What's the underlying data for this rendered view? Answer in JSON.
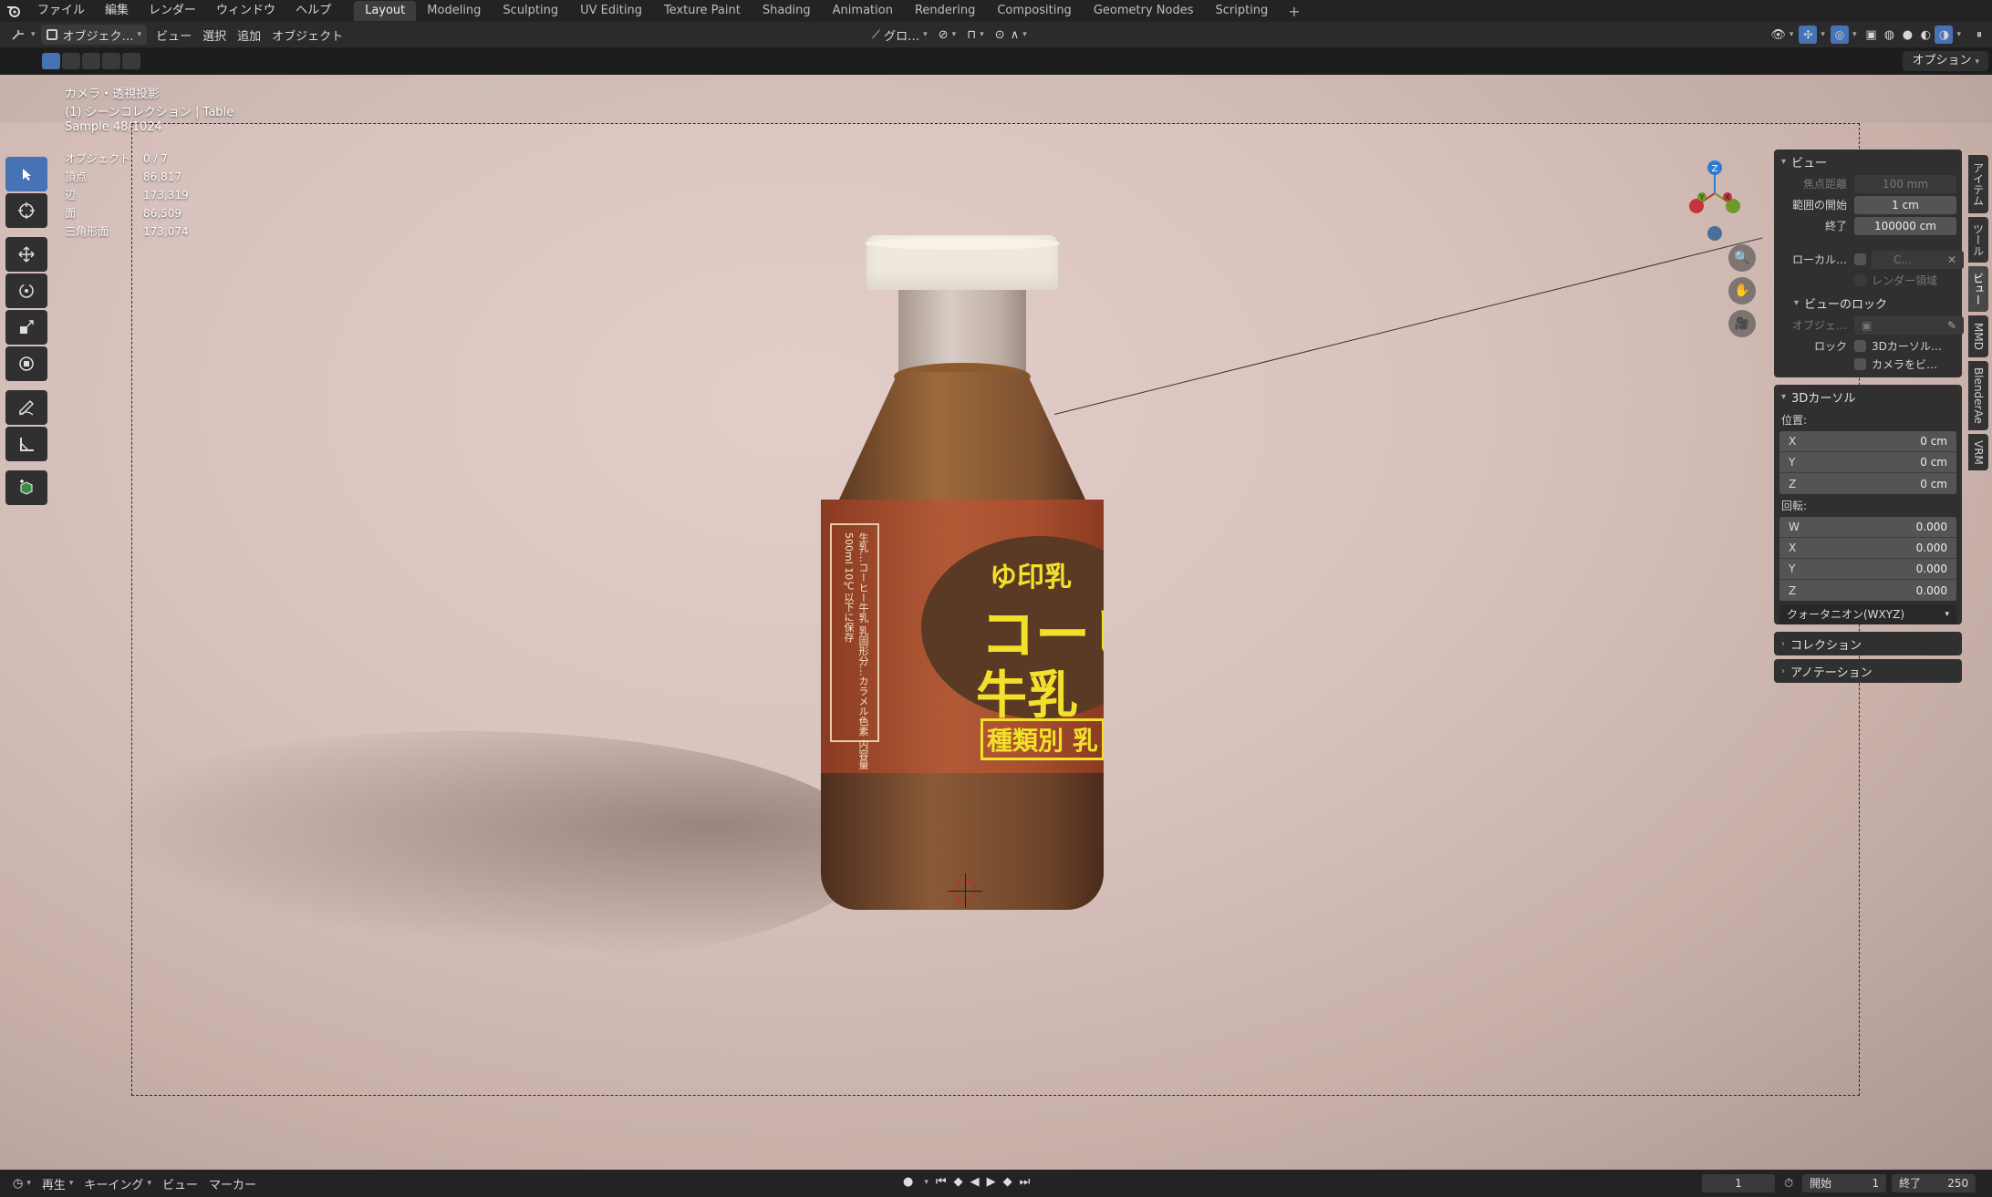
{
  "topbar": {
    "menus": [
      "ファイル",
      "編集",
      "レンダー",
      "ウィンドウ",
      "ヘルプ"
    ],
    "workspaces": [
      "Layout",
      "Modeling",
      "Sculpting",
      "UV Editing",
      "Texture Paint",
      "Shading",
      "Animation",
      "Rendering",
      "Compositing",
      "Geometry Nodes",
      "Scripting"
    ],
    "add_symbol": "+"
  },
  "header": {
    "mode": "オブジェク…",
    "menus": [
      "ビュー",
      "選択",
      "追加",
      "オブジェクト"
    ],
    "transform_orientation": "グロ…",
    "options_label": "オプション"
  },
  "overlay": {
    "view_name": "カメラ・透視投影",
    "collection": "(1) シーンコレクション | Table",
    "sample": "Sample 48/1024",
    "stats": [
      {
        "k": "オブジェクト",
        "v": "0 / 7"
      },
      {
        "k": "頂点",
        "v": "86,817"
      },
      {
        "k": "辺",
        "v": "173,319"
      },
      {
        "k": "面",
        "v": "86,509"
      },
      {
        "k": "三角形面",
        "v": "173,074"
      }
    ]
  },
  "gizmo": {
    "z": "Z",
    "y": "Y",
    "x": "X"
  },
  "label_art": {
    "vertical_text": "生乳…コーヒー牛乳 乳固形分…カラメル色素 内容量500ml 10℃以下に保存",
    "brand": "ゆ印乳",
    "title1": "コーヒ",
    "title2": "牛乳",
    "sub": "種類別 乳"
  },
  "npanel": {
    "view": {
      "title": "ビュー",
      "focal_label": "焦点距離",
      "focal_value": "100 mm",
      "clip_start_label": "範囲の開始",
      "clip_start_value": "1 cm",
      "clip_end_label": "終了",
      "clip_end_value": "100000 cm",
      "local_label": "ローカル…",
      "local_value": "C…",
      "render_region": "レンダー領域",
      "lock_title": "ビューのロック",
      "lock_obj_label": "オブジェ…",
      "lock_label": "ロック",
      "lock_cursor": "3Dカーソル…",
      "lock_camera": "カメラをビ…"
    },
    "cursor": {
      "title": "3Dカーソル",
      "location_label": "位置:",
      "location": [
        {
          "ax": "X",
          "v": "0 cm"
        },
        {
          "ax": "Y",
          "v": "0 cm"
        },
        {
          "ax": "Z",
          "v": "0 cm"
        }
      ],
      "rotation_label": "回転:",
      "rotation": [
        {
          "ax": "W",
          "v": "0.000"
        },
        {
          "ax": "X",
          "v": "0.000"
        },
        {
          "ax": "Y",
          "v": "0.000"
        },
        {
          "ax": "Z",
          "v": "0.000"
        }
      ],
      "rotation_mode": "クォータニオン(WXYZ)"
    },
    "collection_title": "コレクション",
    "annotation_title": "アノテーション"
  },
  "tabs": [
    "アイテム",
    "ツール",
    "ビュー",
    "MMD",
    "BlenderAe",
    "VRM"
  ],
  "timeline": {
    "menus": [
      "再生",
      "キーイング",
      "ビュー",
      "マーカー"
    ],
    "current_frame": "1",
    "start_label": "開始",
    "start_value": "1",
    "end_label": "終了",
    "end_value": "250"
  },
  "colors": {
    "accent": "#4772b3",
    "x_axis": "#c8313e",
    "y_axis": "#6d9b2a",
    "z_axis": "#2f7bcf"
  }
}
